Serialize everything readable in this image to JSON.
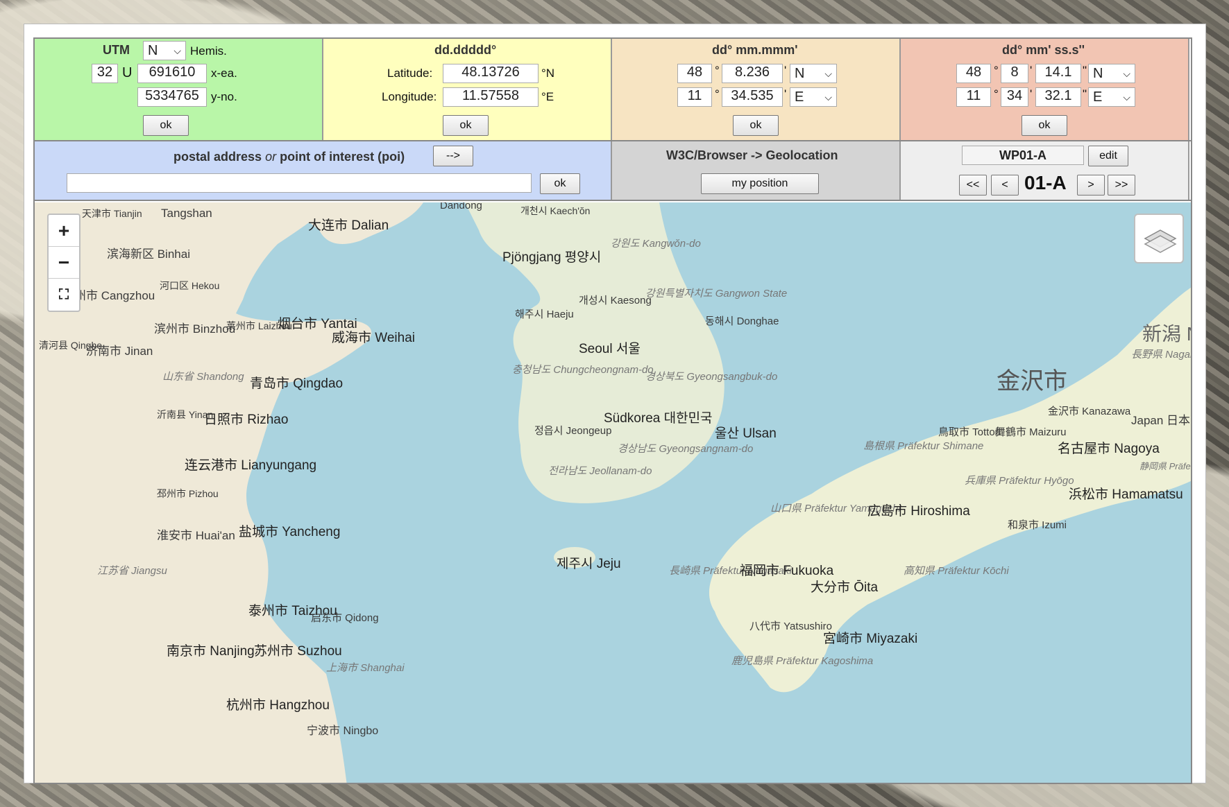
{
  "utm": {
    "title": "UTM",
    "hemisphere": "N",
    "hemisphere_label": "Hemis.",
    "zone": "32",
    "band": "U",
    "easting": "691610",
    "easting_label": "x-ea.",
    "northing": "5334765",
    "northing_label": "y-no.",
    "ok": "ok"
  },
  "dd": {
    "title": "dd.ddddd°",
    "lat_label": "Latitude:",
    "lat": "48.13726",
    "lat_unit": "°N",
    "lon_label": "Longitude:",
    "lon": "11.57558",
    "lon_unit": "°E",
    "ok": "ok"
  },
  "dm": {
    "title": "dd° mm.mmm'",
    "lat_deg": "48",
    "lat_min": "8.236",
    "lat_hem": "N",
    "lon_deg": "11",
    "lon_min": "34.535",
    "lon_hem": "E",
    "deg_sym": "°",
    "min_sym": "'",
    "ok": "ok"
  },
  "dms": {
    "title": "dd° mm' ss.s''",
    "lat_deg": "48",
    "lat_min": "8",
    "lat_sec": "14.1",
    "lat_hem": "N",
    "lon_deg": "11",
    "lon_min": "34",
    "lon_sec": "32.1",
    "lon_hem": "E",
    "deg_sym": "°",
    "min_sym": "'",
    "sec_sym": "\"",
    "ok": "ok"
  },
  "poi": {
    "title_a": "postal address",
    "title_or": "or",
    "title_b": "point of interest (poi)",
    "arrow": "-->",
    "value": "",
    "ok": "ok"
  },
  "geo": {
    "title": "W3C/Browser -> Geolocation",
    "button": "my position"
  },
  "waypoint": {
    "name": "WP01-A",
    "edit": "edit",
    "first": "<<",
    "prev": "<",
    "current": "01-A",
    "next": ">",
    "last": ">>"
  },
  "map": {
    "zoom_in": "+",
    "zoom_out": "−",
    "labels": [
      {
        "text": "Tangshan"
      },
      {
        "text": "天津市 Tianjin"
      },
      {
        "text": "滨海新区 Binhai"
      },
      {
        "text": "大连市 Dalian"
      },
      {
        "text": "개천시 Kaech'ŏn"
      },
      {
        "text": "Pjöngjang 평양시"
      },
      {
        "text": "강원도 Kangwŏn-do"
      },
      {
        "text": "沧州市 Cangzhou"
      },
      {
        "text": "河口区 Hekou"
      },
      {
        "text": "滨州市 Binzhou"
      },
      {
        "text": "莱州市 Laizhou"
      },
      {
        "text": "烟台市 Yantai"
      },
      {
        "text": "威海市 Weihai"
      },
      {
        "text": "개성시 Kaesong"
      },
      {
        "text": "해주시 Haeju"
      },
      {
        "text": "강원특별자치도 Gangwon State"
      },
      {
        "text": "동해시 Donghae"
      },
      {
        "text": "Seoul 서울"
      },
      {
        "text": "济南市 Jinan"
      },
      {
        "text": "清河县 Qinghe"
      },
      {
        "text": "山东省 Shandong"
      },
      {
        "text": "青岛市 Qingdao"
      },
      {
        "text": "충청남도 Chungcheongnam-do"
      },
      {
        "text": "경상북도 Gyeongsangbuk-do"
      },
      {
        "text": "Südkorea 대한민국"
      },
      {
        "text": "울산 Ulsan"
      },
      {
        "text": "沂南县 Yinan"
      },
      {
        "text": "日照市 Rizhao"
      },
      {
        "text": "정읍시 Jeongeup"
      },
      {
        "text": "경상남도 Gyeongsangnam-do"
      },
      {
        "text": "전라남도 Jeollanam-do"
      },
      {
        "text": "连云港市 Lianyungang"
      },
      {
        "text": "邳州市 Pizhou"
      },
      {
        "text": "淮安市 Huai'an"
      },
      {
        "text": "盐城市 Yancheng"
      },
      {
        "text": "제주시 Jeju"
      },
      {
        "text": "江苏省 Jiangsu"
      },
      {
        "text": "泰州市 Taizhou"
      },
      {
        "text": "启东市 Qidong"
      },
      {
        "text": "南京市 Nanjing"
      },
      {
        "text": "苏州市 Suzhou"
      },
      {
        "text": "上海市 Shanghai"
      },
      {
        "text": "杭州市 Hangzhou"
      },
      {
        "text": "宁波市 Ningbo"
      },
      {
        "text": "金沢市"
      },
      {
        "text": "金沢市 Kanazawa"
      },
      {
        "text": "鳥取市 Tottori"
      },
      {
        "text": "舞鶴市 Maizuru"
      },
      {
        "text": "名古屋市 Nagoya"
      },
      {
        "text": "島根県 Präfektur Shimane"
      },
      {
        "text": "兵庫県 Präfektur Hyōgo"
      },
      {
        "text": "浜松市 Hamamatsu"
      },
      {
        "text": "山口県 Präfektur Yamaguchi"
      },
      {
        "text": "広島市 Hiroshima"
      },
      {
        "text": "和泉市 Izumi"
      },
      {
        "text": "長崎県 Präfektur Nagasaki"
      },
      {
        "text": "福岡市 Fukuoka"
      },
      {
        "text": "大分市 Ōita"
      },
      {
        "text": "高知県 Präfektur Kōchi"
      },
      {
        "text": "八代市 Yatsushiro"
      },
      {
        "text": "宮崎市 Miyazaki"
      },
      {
        "text": "鹿児島県 Präfektur Kagoshima"
      },
      {
        "text": "Japan 日本"
      },
      {
        "text": "新潟 Niig"
      },
      {
        "text": "長野県 Nagano"
      },
      {
        "text": "静岡県 Präfektur Shizuoka"
      },
      {
        "text": "Dandong"
      }
    ]
  }
}
